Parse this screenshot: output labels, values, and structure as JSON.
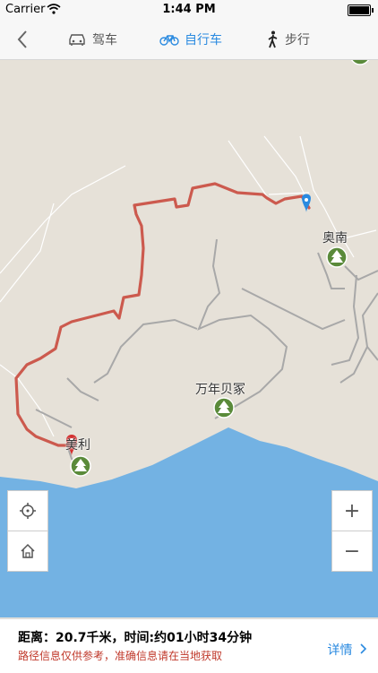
{
  "status_bar": {
    "carrier": "Carrier",
    "time": "1:44 PM"
  },
  "nav": {
    "tabs": [
      {
        "label": "驾车",
        "icon": "car-icon"
      },
      {
        "label": "自行车",
        "icon": "bicycle-icon",
        "active": true
      },
      {
        "label": "步行",
        "icon": "walking-icon"
      }
    ],
    "accent_color": "#2a8ae0"
  },
  "map": {
    "places": [
      {
        "name": "奥南"
      },
      {
        "name": "万年贝冢"
      },
      {
        "name": "美利"
      }
    ],
    "route_color": "#cc5a4e",
    "water_color": "#73b2e3"
  },
  "controls": {
    "locate_icon": "locate-icon",
    "home_icon": "home-icon",
    "zoom_in": "+",
    "zoom_out": "−"
  },
  "route_info": {
    "summary": "距离：20.7千米，时间:约01小时34分钟",
    "disclaimer": "路径信息仅供参考，准确信息请在当地获取",
    "detail_label": "详情"
  }
}
